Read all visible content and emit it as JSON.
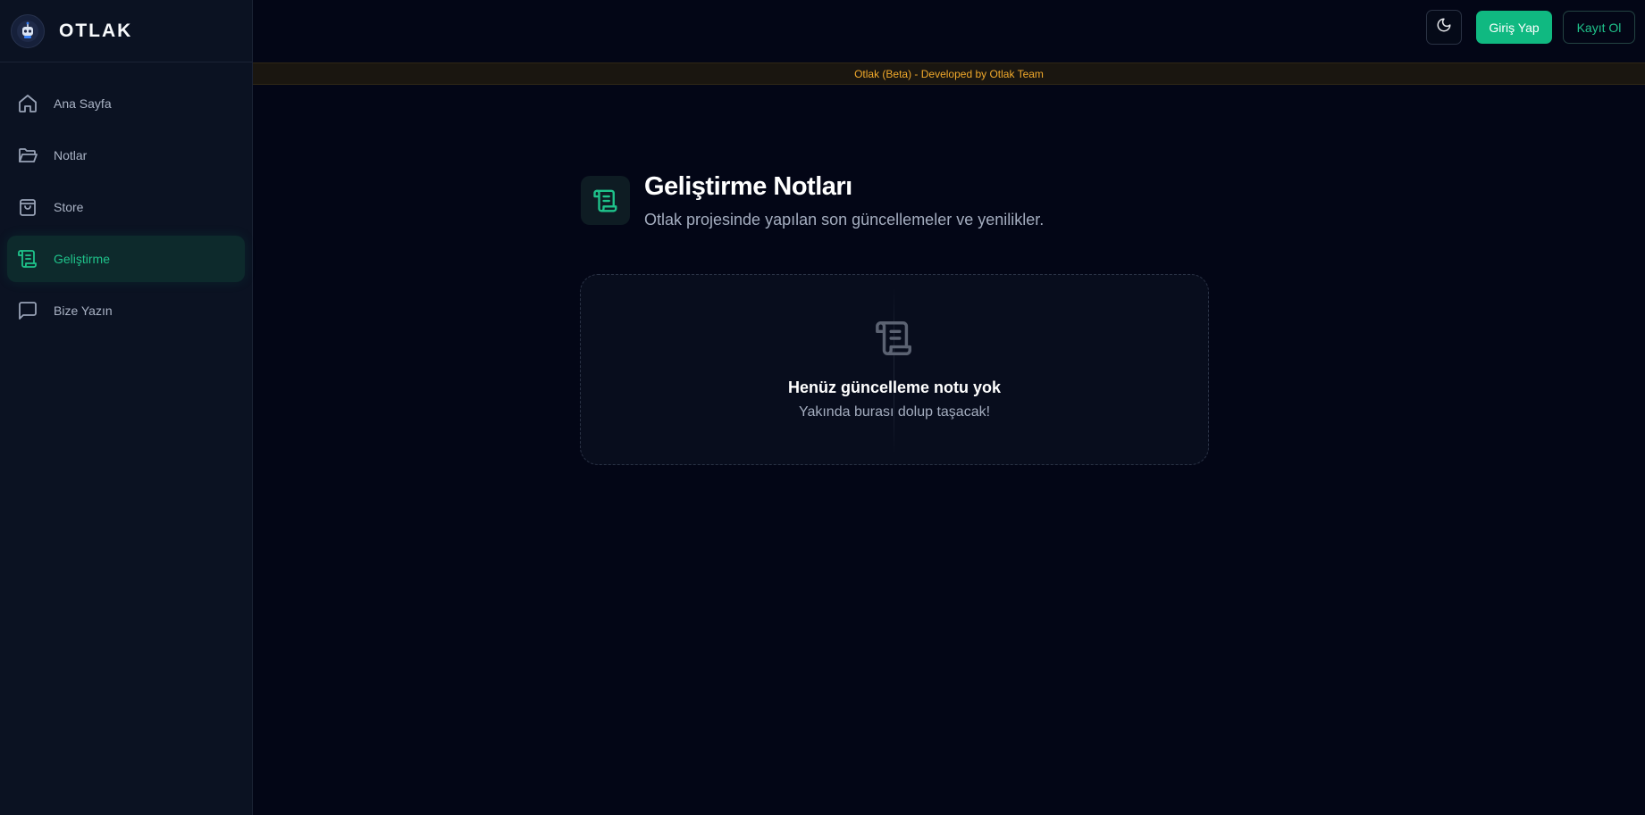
{
  "brand": {
    "name": "OTLAK",
    "logo_icon": "robot-logo-icon"
  },
  "sidebar": {
    "items": [
      {
        "label": "Ana Sayfa",
        "icon": "home-icon",
        "active": false
      },
      {
        "label": "Notlar",
        "icon": "folder-open-icon",
        "active": false
      },
      {
        "label": "Store",
        "icon": "shopping-bag-icon",
        "active": false
      },
      {
        "label": "Geliştirme",
        "icon": "scroll-icon",
        "active": true
      },
      {
        "label": "Bize Yazın",
        "icon": "message-square-icon",
        "active": false
      }
    ]
  },
  "topbar": {
    "theme_icon": "moon-icon",
    "login_label": "Giriş Yap",
    "register_label": "Kayıt Ol"
  },
  "banner": {
    "text": "Otlak (Beta) - Developed by Otlak Team"
  },
  "main": {
    "header_icon": "scroll-icon",
    "title": "Geliştirme Notları",
    "subtitle": "Otlak projesinde yapılan son güncellemeler ve yenilikler.",
    "empty_state": {
      "icon": "scroll-icon",
      "title": "Henüz güncelleme notu yok",
      "subtitle": "Yakında burası dolup taşacak!"
    }
  },
  "colors": {
    "background": "#030616",
    "sidebar": "#0b1222",
    "accent": "#10b981",
    "banner_text": "#f1a92b"
  }
}
